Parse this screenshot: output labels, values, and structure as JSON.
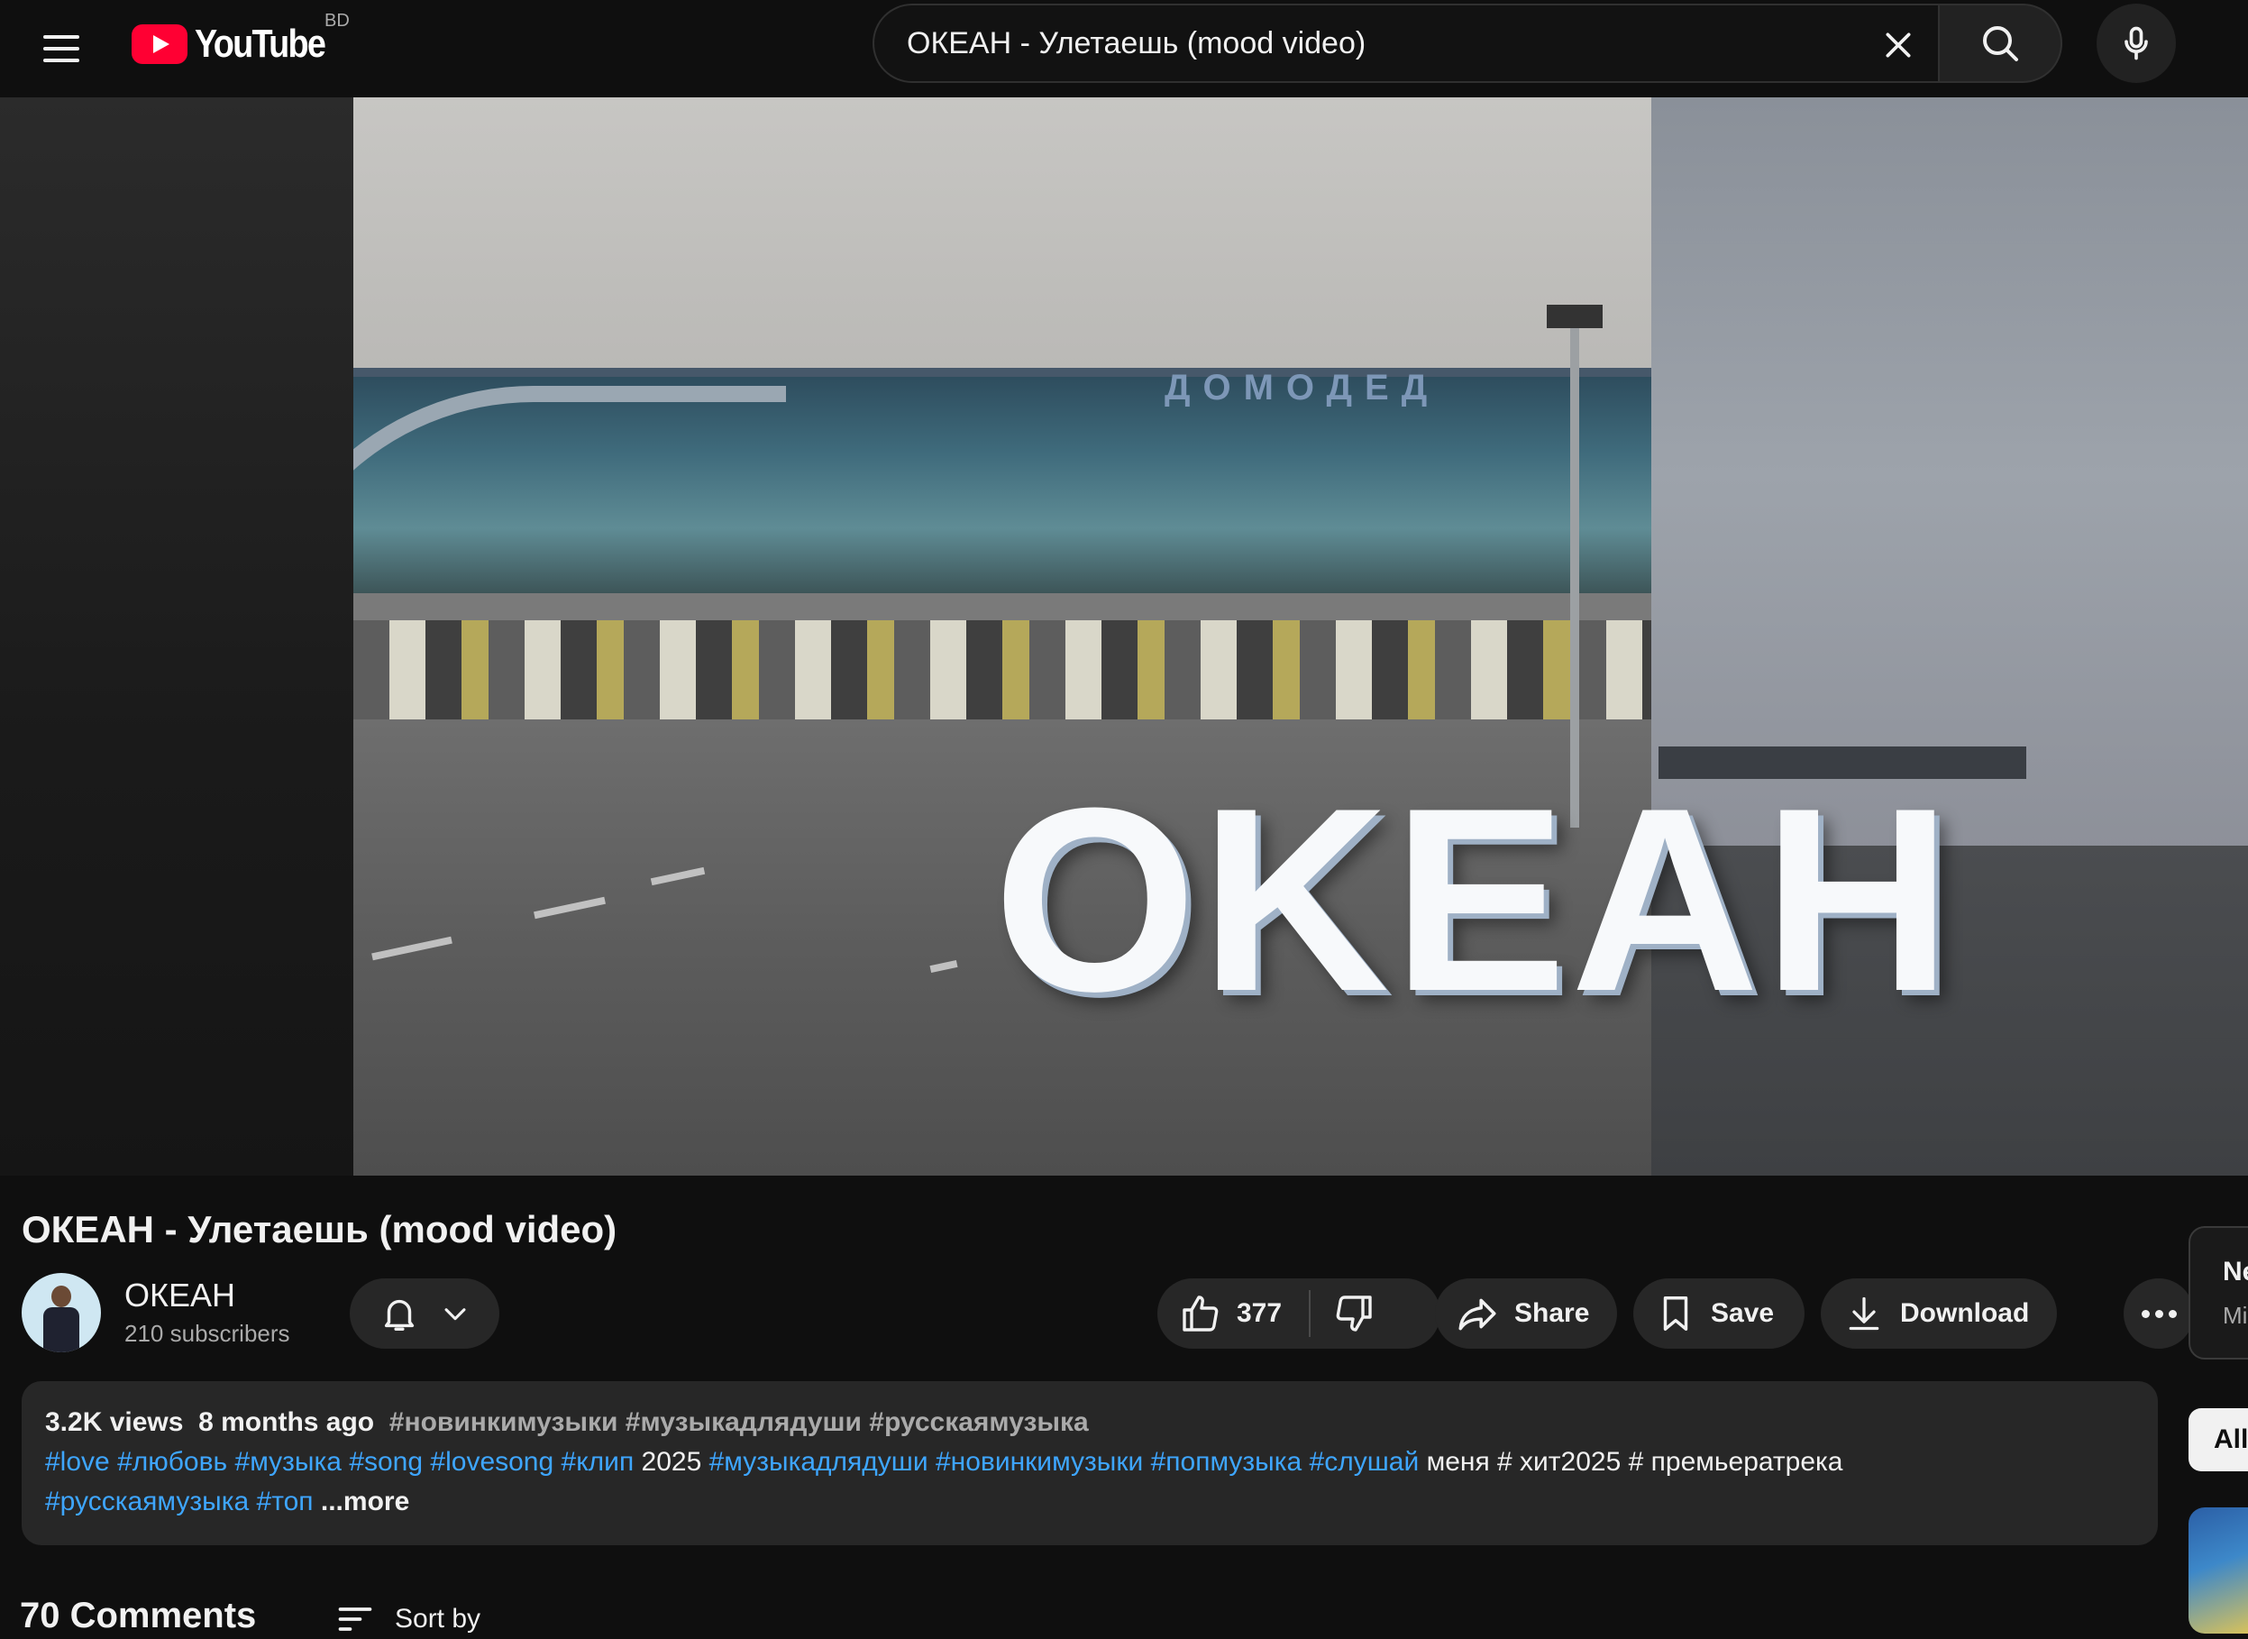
{
  "header": {
    "logo_text": "YouTube",
    "country": "BD",
    "search_value": "ОКЕАН - Улетаешь (mood video)"
  },
  "player": {
    "overlay_text": "OKEAH",
    "sign_text": "ДОМОДЕД"
  },
  "video": {
    "title": "ОКЕАН - Улетаешь (mood video)",
    "channel_name": "ОКЕАН",
    "subscribers": "210 subscribers",
    "likes": "377",
    "share_label": "Share",
    "save_label": "Save",
    "download_label": "Download"
  },
  "description": {
    "views": "3.2K views",
    "age": "8 months ago",
    "top_tags": "#новинкимузыки #музыкадлядуши #русскаямузыка",
    "line2": [
      {
        "text": "#love",
        "kind": "link"
      },
      {
        "text": " ",
        "kind": "plain"
      },
      {
        "text": "#любовь",
        "kind": "link"
      },
      {
        "text": " ",
        "kind": "plain"
      },
      {
        "text": "#музыка",
        "kind": "link"
      },
      {
        "text": " ",
        "kind": "plain"
      },
      {
        "text": "#song",
        "kind": "link"
      },
      {
        "text": " ",
        "kind": "plain"
      },
      {
        "text": "#lovesong",
        "kind": "link"
      },
      {
        "text": " ",
        "kind": "plain"
      },
      {
        "text": "#клип",
        "kind": "link"
      },
      {
        "text": " 2025 ",
        "kind": "plain"
      },
      {
        "text": "#музыкадлядуши",
        "kind": "link"
      },
      {
        "text": " ",
        "kind": "plain"
      },
      {
        "text": "#новинкимузыки",
        "kind": "link"
      },
      {
        "text": " ",
        "kind": "plain"
      },
      {
        "text": "#попмузыка",
        "kind": "link"
      },
      {
        "text": " ",
        "kind": "plain"
      },
      {
        "text": "#слушай",
        "kind": "link"
      },
      {
        "text": " меня # хит2025 # премьератрека",
        "kind": "plain"
      }
    ],
    "line3_tags": [
      "#русскаямузыка",
      "#топ"
    ],
    "more_label": "...more"
  },
  "comments": {
    "count_label": "70 Comments",
    "sort_label": "Sort by"
  },
  "sidebar": {
    "card_title": "Ne",
    "card_sub": "Mi",
    "chip_all": "All"
  }
}
